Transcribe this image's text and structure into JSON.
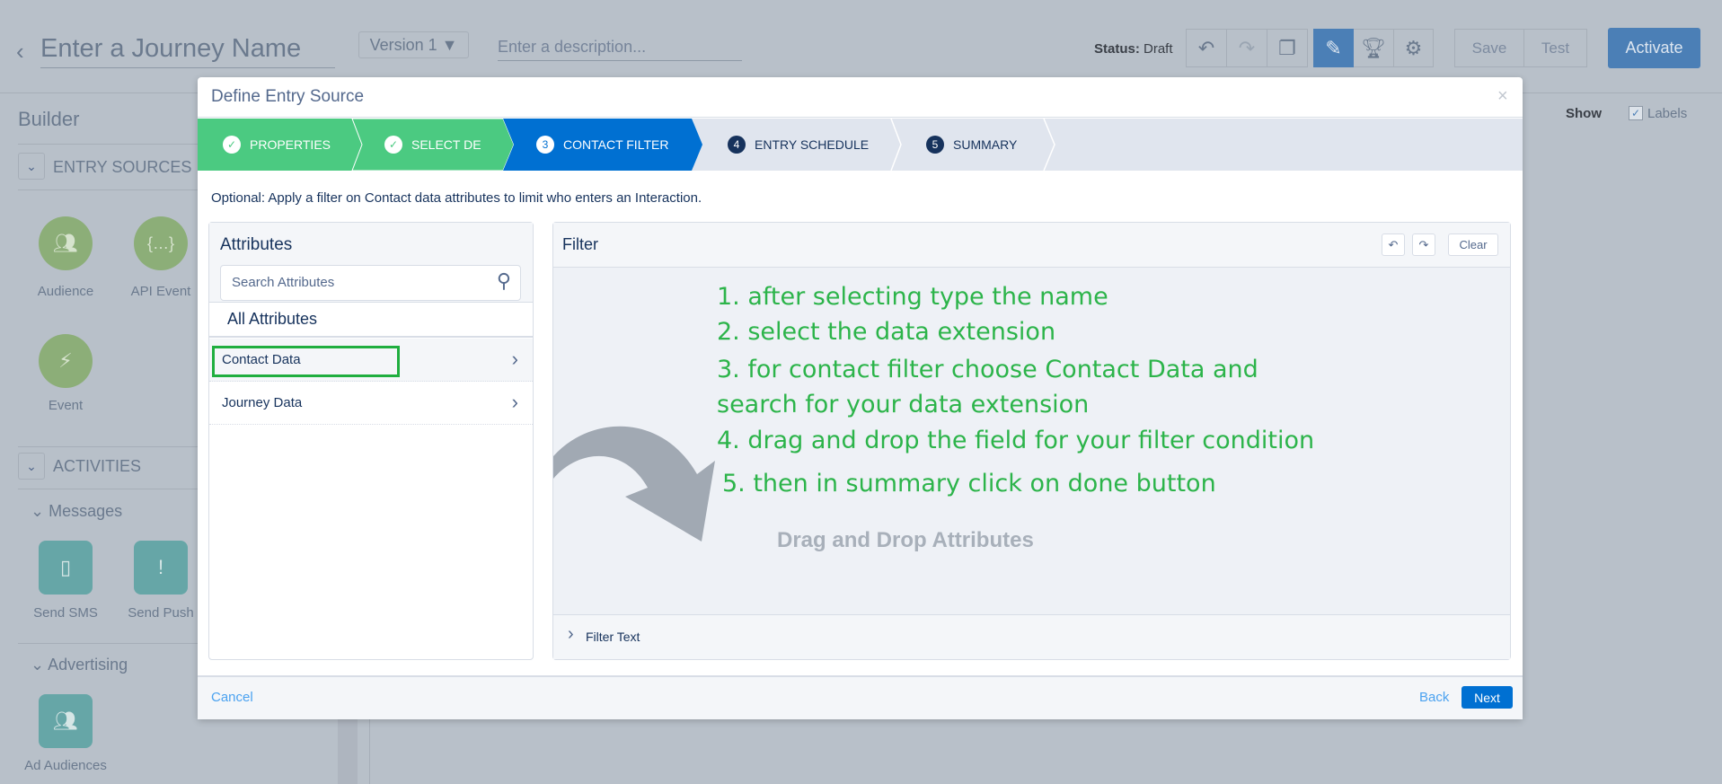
{
  "header": {
    "journey_name_placeholder": "Enter a Journey Name",
    "version": "Version 1 ▼",
    "description_placeholder": "Enter a description...",
    "status_label": "Status:",
    "status_value": "Draft",
    "save": "Save",
    "test": "Test",
    "activate": "Activate"
  },
  "canvas": {
    "show": "Show",
    "labels": "Labels"
  },
  "sidebar": {
    "title": "Builder",
    "entry_sources": "ENTRY SOURCES",
    "entry_items": [
      {
        "label": "Audience"
      },
      {
        "label": "API Event"
      },
      {
        "label": "Event"
      }
    ],
    "activities": "ACTIVITIES",
    "messages": "Messages",
    "message_items": [
      {
        "label": "Send SMS"
      },
      {
        "label": "Send Push"
      }
    ],
    "advertising": "Advertising",
    "ad_items": [
      {
        "label": "Ad Audiences"
      }
    ]
  },
  "modal": {
    "title": "Define Entry Source",
    "close": "×",
    "steps": [
      {
        "num": "✓",
        "label": "PROPERTIES",
        "state": "done"
      },
      {
        "num": "✓",
        "label": "SELECT DE",
        "state": "done"
      },
      {
        "num": "3",
        "label": "CONTACT FILTER",
        "state": "active"
      },
      {
        "num": "4",
        "label": "ENTRY SCHEDULE",
        "state": "pending"
      },
      {
        "num": "5",
        "label": "SUMMARY",
        "state": "pending"
      }
    ],
    "description": "Optional: Apply a filter on Contact data attributes to limit who enters an Interaction.",
    "attributes": {
      "title": "Attributes",
      "search_placeholder": "Search Attributes",
      "all": "All Attributes",
      "items": [
        {
          "label": "Contact Data"
        },
        {
          "label": "Journey Data"
        }
      ]
    },
    "filter": {
      "title": "Filter",
      "clear": "Clear",
      "drop_hint": "Drag and Drop Attributes",
      "filter_text": "Filter Text"
    },
    "annotations": [
      "1. after selecting type the name",
      "2. select the data extension",
      "3. for contact filter choose Contact Data and",
      "search for your data extension",
      "4. drag and drop the field for your filter condition",
      "5. then in summary click on done button"
    ],
    "cancel": "Cancel",
    "back": "Back",
    "next": "Next"
  },
  "colors": {
    "done": "#4bca81",
    "active": "#0070d2",
    "annotation": "#2cb44a",
    "highlight_box": "#1fae3f"
  }
}
